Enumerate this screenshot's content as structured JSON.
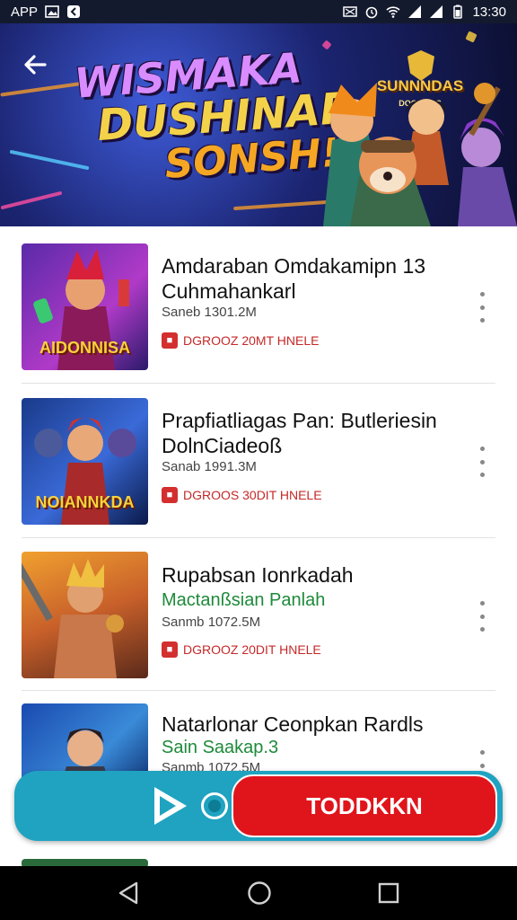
{
  "status_bar": {
    "carrier": "APP",
    "time": "13:30",
    "icons": [
      "image-icon",
      "app-icon",
      "nfc-icon",
      "alarm-icon",
      "wifi-icon",
      "signal-icon",
      "signal-icon",
      "battery-icon"
    ]
  },
  "hero": {
    "title_line1": "WISMAKA",
    "title_line2": "DUSHINAR",
    "title_line3": "SONSH!",
    "badge_title": "SUNNNDAS",
    "badge_sub": "DOCHIKES",
    "back_icon": "arrow-left-icon"
  },
  "items": [
    {
      "thumb_caption": "AIDONNISA",
      "title_line1": "Amdaraban Omdakamipn 13",
      "title_line2": "Cuhmahankarl",
      "subtitle": "",
      "meta": "Saneb 1301.2M",
      "tag": "DGROOZ 20MT HNELE"
    },
    {
      "thumb_caption": "NOIANNKDA",
      "title_line1": "Prapfiatliagas Pan: Butleriesin",
      "title_line2": "DolnCiadeoß",
      "subtitle": "",
      "meta": "Sanab 1991.3M",
      "tag": "DGROOS 30DIT HNELE"
    },
    {
      "thumb_caption": "",
      "title_line1": "Rupabsan Ionrkadah",
      "title_line2": "",
      "subtitle": "Mactanßsian Panlah",
      "meta": "Sanmb 1072.5M",
      "tag": "DGROOZ 20DIT HNELE"
    },
    {
      "thumb_caption": "",
      "title_line1": "Natarlonar Ceonpkan Rardls",
      "title_line2": "",
      "subtitle": "Sain Saakap.3",
      "meta": "Sanmb 1072.5M",
      "tag": ""
    }
  ],
  "float_bar": {
    "action_label": "TODDKKN",
    "play_icon": "play-icon"
  },
  "nav": {
    "back_icon": "nav-back-icon",
    "home_icon": "nav-home-icon",
    "recents_icon": "nav-recents-icon"
  },
  "colors": {
    "accent_red": "#e0151c",
    "bar_teal": "#1fa3c0",
    "subtitle_green": "#1e8a3a"
  }
}
